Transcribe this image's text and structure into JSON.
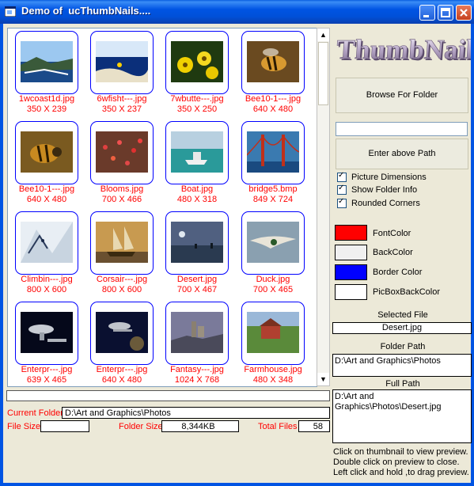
{
  "window": {
    "title": "Demo of  ucThumbNails...."
  },
  "thumbs": [
    {
      "name": "1wcoast1d.jpg",
      "dims": "350 X 239"
    },
    {
      "name": "6wfisht---.jpg",
      "dims": "350 X 237"
    },
    {
      "name": "7wbutte---.jpg",
      "dims": "350 X 250"
    },
    {
      "name": "Bee10-1---.jpg",
      "dims": "640 X 480"
    },
    {
      "name": "Bee10-1---.jpg",
      "dims": "640 X 480"
    },
    {
      "name": "Blooms.jpg",
      "dims": "700 X 466"
    },
    {
      "name": "Boat.jpg",
      "dims": "480 X 318"
    },
    {
      "name": "bridge5.bmp",
      "dims": "849 X 724"
    },
    {
      "name": "Climbin---.jpg",
      "dims": "800 X 600"
    },
    {
      "name": "Corsair---.jpg",
      "dims": "800 X 600"
    },
    {
      "name": "Desert.jpg",
      "dims": "700 X 467"
    },
    {
      "name": "Duck.jpg",
      "dims": "700 X 465"
    },
    {
      "name": "Enterpr---.jpg",
      "dims": "639 X 465"
    },
    {
      "name": "Enterpr---.jpg",
      "dims": "640 X 480"
    },
    {
      "name": "Fantasy---.jpg",
      "dims": "1024 X 768"
    },
    {
      "name": "Farmhouse.jpg",
      "dims": "480 X 348"
    }
  ],
  "status": {
    "current_folder_label": "Current Folder",
    "current_folder_value": "D:\\Art and Graphics\\Photos",
    "file_size_label": "File Size",
    "file_size_value": "",
    "folder_size_label": "Folder Size",
    "folder_size_value": "8,344KB",
    "total_files_label": "Total Files",
    "total_files_value": "58"
  },
  "panel": {
    "logo_text": "ThumbNails",
    "browse_label": "Browse For Folder",
    "path_input_value": "",
    "enter_path_label": "Enter above Path",
    "checkboxes": [
      {
        "label": "Picture Dimensions",
        "checked": true
      },
      {
        "label": "Show Folder Info",
        "checked": true
      },
      {
        "label": "Rounded Corners",
        "checked": true
      }
    ],
    "colors": [
      {
        "label": "FontColor",
        "color": "#ff0000"
      },
      {
        "label": "BackColor",
        "color": "#f0f0f0"
      },
      {
        "label": "Border Color",
        "color": "#0000ff"
      },
      {
        "label": "PicBoxBackColor",
        "color": "#ffffff"
      }
    ],
    "selected_file_label": "Selected File",
    "selected_file_value": "Desert.jpg",
    "folder_path_label": "Folder Path",
    "folder_path_value": "D:\\Art and Graphics\\Photos",
    "full_path_label": "Full Path",
    "full_path_value": "D:\\Art and Graphics\\Photos\\Desert.jpg",
    "help": [
      "Click on thumbnail to view preview.",
      "Double click on preview to close.",
      "Left click and hold ,to drag preview."
    ]
  }
}
